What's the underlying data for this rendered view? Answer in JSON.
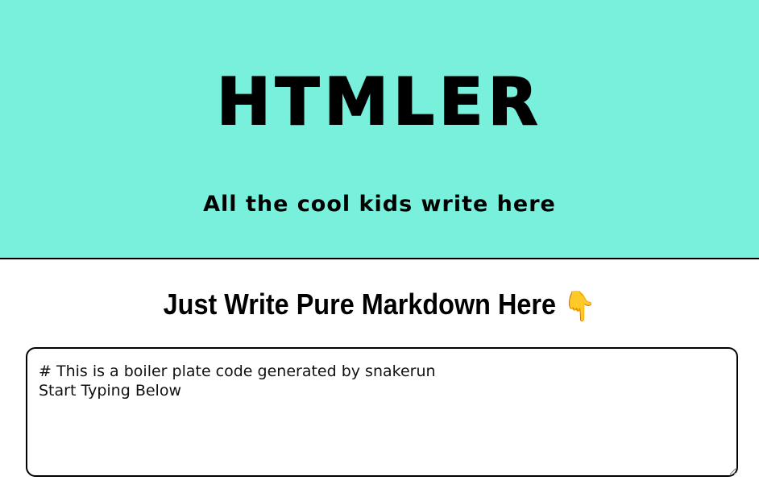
{
  "header": {
    "title": "HTMLER",
    "tagline": "All the cool kids write here",
    "background_color": "#78f0dc"
  },
  "main": {
    "heading": "Just Write Pure Markdown Here",
    "heading_icon": "backhand-index-pointing-down-icon",
    "heading_icon_glyph": "👇",
    "editor": {
      "value": "# This is a boiler plate code generated by snakerun\nStart Typing Below"
    }
  }
}
